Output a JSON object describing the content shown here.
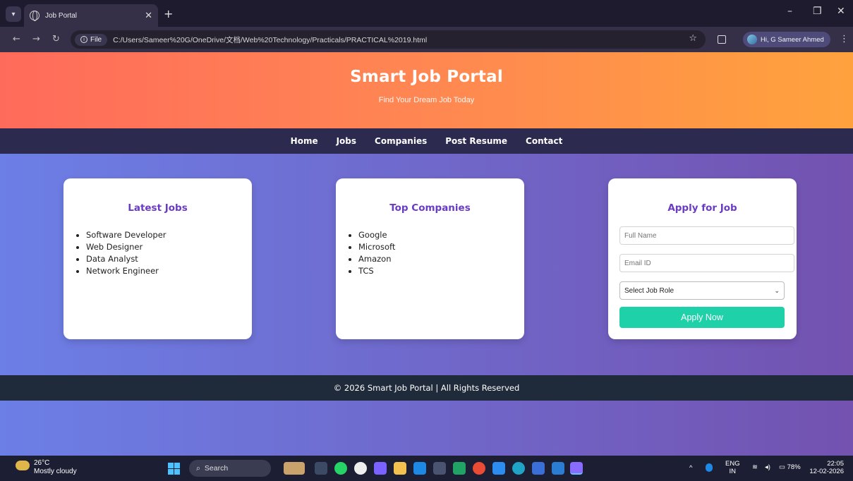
{
  "browser": {
    "tab_title": "Job Portal",
    "file_chip": "File",
    "url": "C:/Users/Sameer%20G/OneDrive/文档/Web%20Technology/Practicals/PRACTICAL%2019.html",
    "profile_label": "Hi, G Sameer Ahmed"
  },
  "hero": {
    "title": "Smart Job Portal",
    "subtitle": "Find Your Dream Job Today"
  },
  "nav": {
    "items": [
      "Home",
      "Jobs",
      "Companies",
      "Post Resume",
      "Contact"
    ]
  },
  "cards": {
    "latest": {
      "title": "Latest Jobs",
      "items": [
        "Software Developer",
        "Web Designer",
        "Data Analyst",
        "Network Engineer"
      ]
    },
    "companies": {
      "title": "Top Companies",
      "items": [
        "Google",
        "Microsoft",
        "Amazon",
        "TCS"
      ]
    },
    "apply": {
      "title": "Apply for Job",
      "name_placeholder": "Full Name",
      "email_placeholder": "Email ID",
      "role_selected": "Select Job Role",
      "button_label": "Apply Now"
    }
  },
  "footer": {
    "text": "© 2026 Smart Job Portal | All Rights Reserved"
  },
  "taskbar": {
    "temperature": "26°C",
    "weather": "Mostly cloudy",
    "search_label": "Search",
    "lang_top": "ENG",
    "lang_bottom": "IN",
    "battery": "78%",
    "time": "22:05",
    "date": "12-02-2026"
  },
  "colors": {
    "hero_start": "#ff6b5b",
    "hero_end": "#ffa23d",
    "nav_bg": "#2c2a4f",
    "accent_purple": "#6a3bc4",
    "apply_button": "#1ed1a8",
    "footer_bg": "#1f2a3a"
  }
}
